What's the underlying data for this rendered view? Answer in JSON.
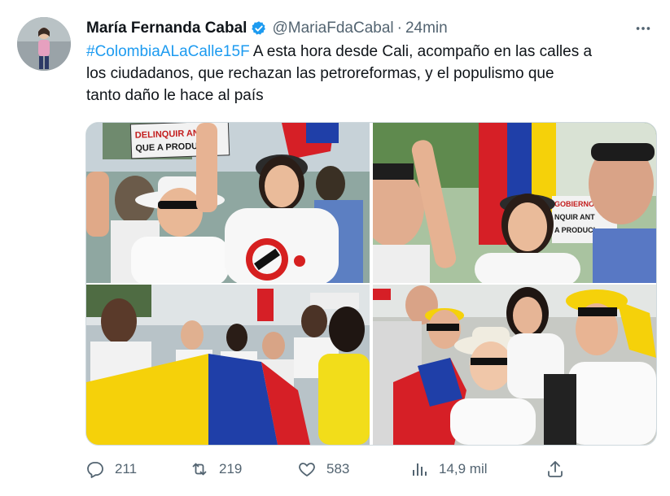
{
  "author": {
    "name": "María Fernanda Cabal",
    "handle": "@MariaFdaCabal",
    "separator": "·",
    "time": "24min"
  },
  "tweet": {
    "hashtag": "#ColombiaALaCalle15F",
    "line1_rest": " A esta hora desde Cali, acompaño en las calles a",
    "line2": "los ciudadanos, que rechazan las petroreformas, y el populismo que",
    "line3": "tanto daño le hace al país"
  },
  "media": {
    "photo1_sign": [
      "DELINQUIR ANT",
      "QUE A PRODUCI"
    ],
    "photo2_sign": [
      "GOBIERNO INCI",
      "NQUIR ANT",
      "A PRODUCI"
    ]
  },
  "metrics": {
    "replies": "211",
    "retweets": "219",
    "likes": "583",
    "views": "14,9 mil"
  },
  "colors": {
    "accent": "#1d9bf0",
    "muted": "#536471",
    "colombia_yellow": "#f5d10a",
    "colombia_blue": "#1f3fa8",
    "colombia_red": "#d61f26"
  }
}
